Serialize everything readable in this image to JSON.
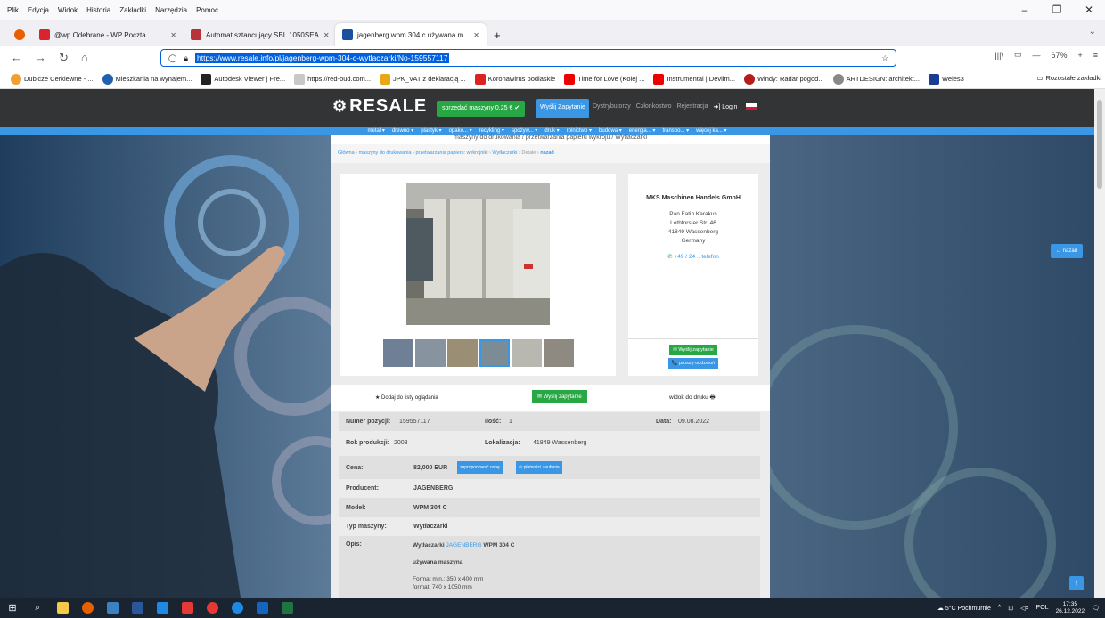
{
  "menu": [
    "Plik",
    "Edycja",
    "Widok",
    "Historia",
    "Zakładki",
    "Narzędzia",
    "Pomoc"
  ],
  "tabs": [
    {
      "title": "@wp Odebrane - WP Poczta",
      "color": "#d9232e"
    },
    {
      "title": "Automat sztancujący SBL 1050SEA",
      "color": "#b8323a"
    },
    {
      "title": "jagenberg wpm 304 c używana m",
      "color": "#1b4fa0"
    }
  ],
  "url": "https://www.resale.info/pl/jagenberg-wpm-304-c-wytlaczarki/No-159557117",
  "zoom": "67%",
  "bookmarks": [
    "Dubicze Cerkiewne - ...",
    "Mieszkania na wynajem...",
    "Autodesk Viewer | Fre...",
    "https://red-bud.com...",
    "JPK_VAT z deklaracją ...",
    "Koronawirus podlaskie",
    "Time for Love (Kolej ...",
    "Instrumental | Devlim...",
    "Windy: Radar pogod...",
    "ARTDESIGN: architekt...",
    "Weles3"
  ],
  "bookmarks_other": "Rozostałe zakładki",
  "site": {
    "logo": "RESALE",
    "sell": "sprzedać maszyny 0,25 € ✔",
    "inquiry": "Wyślij Zapytanie",
    "links": [
      "Dystrybutorzy",
      "Członkostwo",
      "Rejestracja"
    ],
    "login": "➜] Login",
    "categories": [
      "metal ▾",
      "drewno ▾",
      "plastyk ▾",
      "opako... ▾",
      "recykling ▾",
      "spożyw... ▾",
      "druk ▾",
      "rolnictwo ▾",
      "budowa ▾",
      "energia... ▾",
      "transpo... ▾",
      "więcej ka... ▾"
    ],
    "subtitle": "maszyny do drukowania / przetwarzania papieru wykroju / Wytłaczarki",
    "breadcrumb": [
      "Główna",
      "maszyny do drukowania",
      "przetwarzania papieru: wykrojniki",
      "Wytłaczarki",
      "Detale",
      "nazad"
    ]
  },
  "dealer": {
    "name": "MKS Maschinen Handels GmbH",
    "contact": "Pan Fatih Karakus",
    "street": "Lothforster Str. 46",
    "city": "41849 Wassenberg",
    "country": "Germany",
    "phone": "+49 / 24 .. telefon",
    "btn_inquiry": "✉ Wyślij zapytanie",
    "btn_callback": "📞 proszę oddzwoń"
  },
  "actions": {
    "watch": "★ Dodaj do listy oglądania",
    "inquiry": "✉ Wyślij zapytanie",
    "print": "widok do druku 🖶"
  },
  "details": {
    "pos_label": "Numer pozycji:",
    "pos_value": "159557117",
    "qty_label": "Ilość:",
    "qty_value": "1",
    "date_label": "Data:",
    "date_value": "09.08.2022",
    "year_label": "Rok produkcji:",
    "year_value": "2003",
    "loc_label": "Lokalizacja:",
    "loc_value": "41849 Wassenberg",
    "price_label": "Cena:",
    "price_value": "82,000 EUR",
    "price_offer": "zaproponować cenę",
    "price_secure": "⊙ płatności zaufania",
    "maker_label": "Producent:",
    "maker_value": "JAGENBERG",
    "model_label": "Model:",
    "model_value": "WPM 304 C",
    "type_label": "Typ maszyny:",
    "type_value": "Wytłaczarki",
    "desc_label": "Opis:",
    "desc_head_a": "Wytłaczarki",
    "desc_head_b": "JAGENBERG",
    "desc_head_c": "WPM 304 C",
    "desc_used": "używana maszyna",
    "desc_lines": [
      "Format min.: 350 x 400 mm",
      "format: 740 x 1050 mm"
    ]
  },
  "back": "← nazad",
  "taskbar": {
    "weather": "5°C Pochmurnie",
    "lang": "POL",
    "time": "17:35",
    "date": "26.12.2022"
  }
}
